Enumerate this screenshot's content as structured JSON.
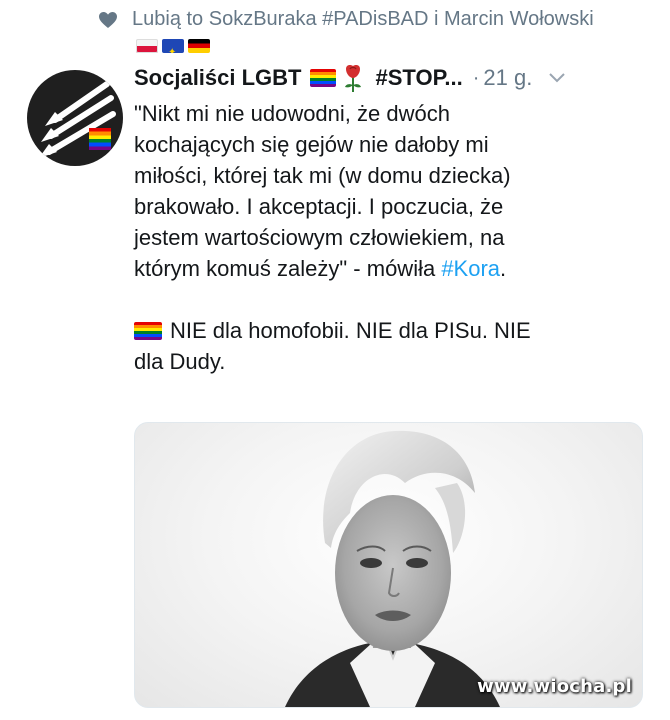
{
  "social_context": {
    "text": "Lubią to SokzBuraka #PADisBAD i Marcin Wołowski",
    "flags": [
      "flag-pl",
      "flag-eu",
      "flag-de"
    ]
  },
  "tweet": {
    "author_name": "Socjaliści LGBT",
    "handle_fragment": "#STOP...",
    "separator": "·",
    "time": "21 g.",
    "text_lines": [
      "\"Nikt mi nie udowodni, że dwóch",
      "kochających się gejów nie dałoby mi",
      "miłości, której tak mi (w domu dziecka)",
      "brakowało. I akceptacji. I poczucia, że",
      "jestem wartościowym człowiekiem, na"
    ],
    "last_line_prefix": "którym komuś zależy\" - mówiła ",
    "hashtag": "#Kora",
    "last_line_suffix": ".",
    "second_para_line1": "NIE dla homofobii. NIE dla PISu. NIE",
    "second_para_line2": "dla Dudy."
  },
  "watermark": "www.wiocha.pl",
  "colors": {
    "link": "#1da1f2",
    "secondary_text": "#657786",
    "primary_text": "#14171a"
  }
}
